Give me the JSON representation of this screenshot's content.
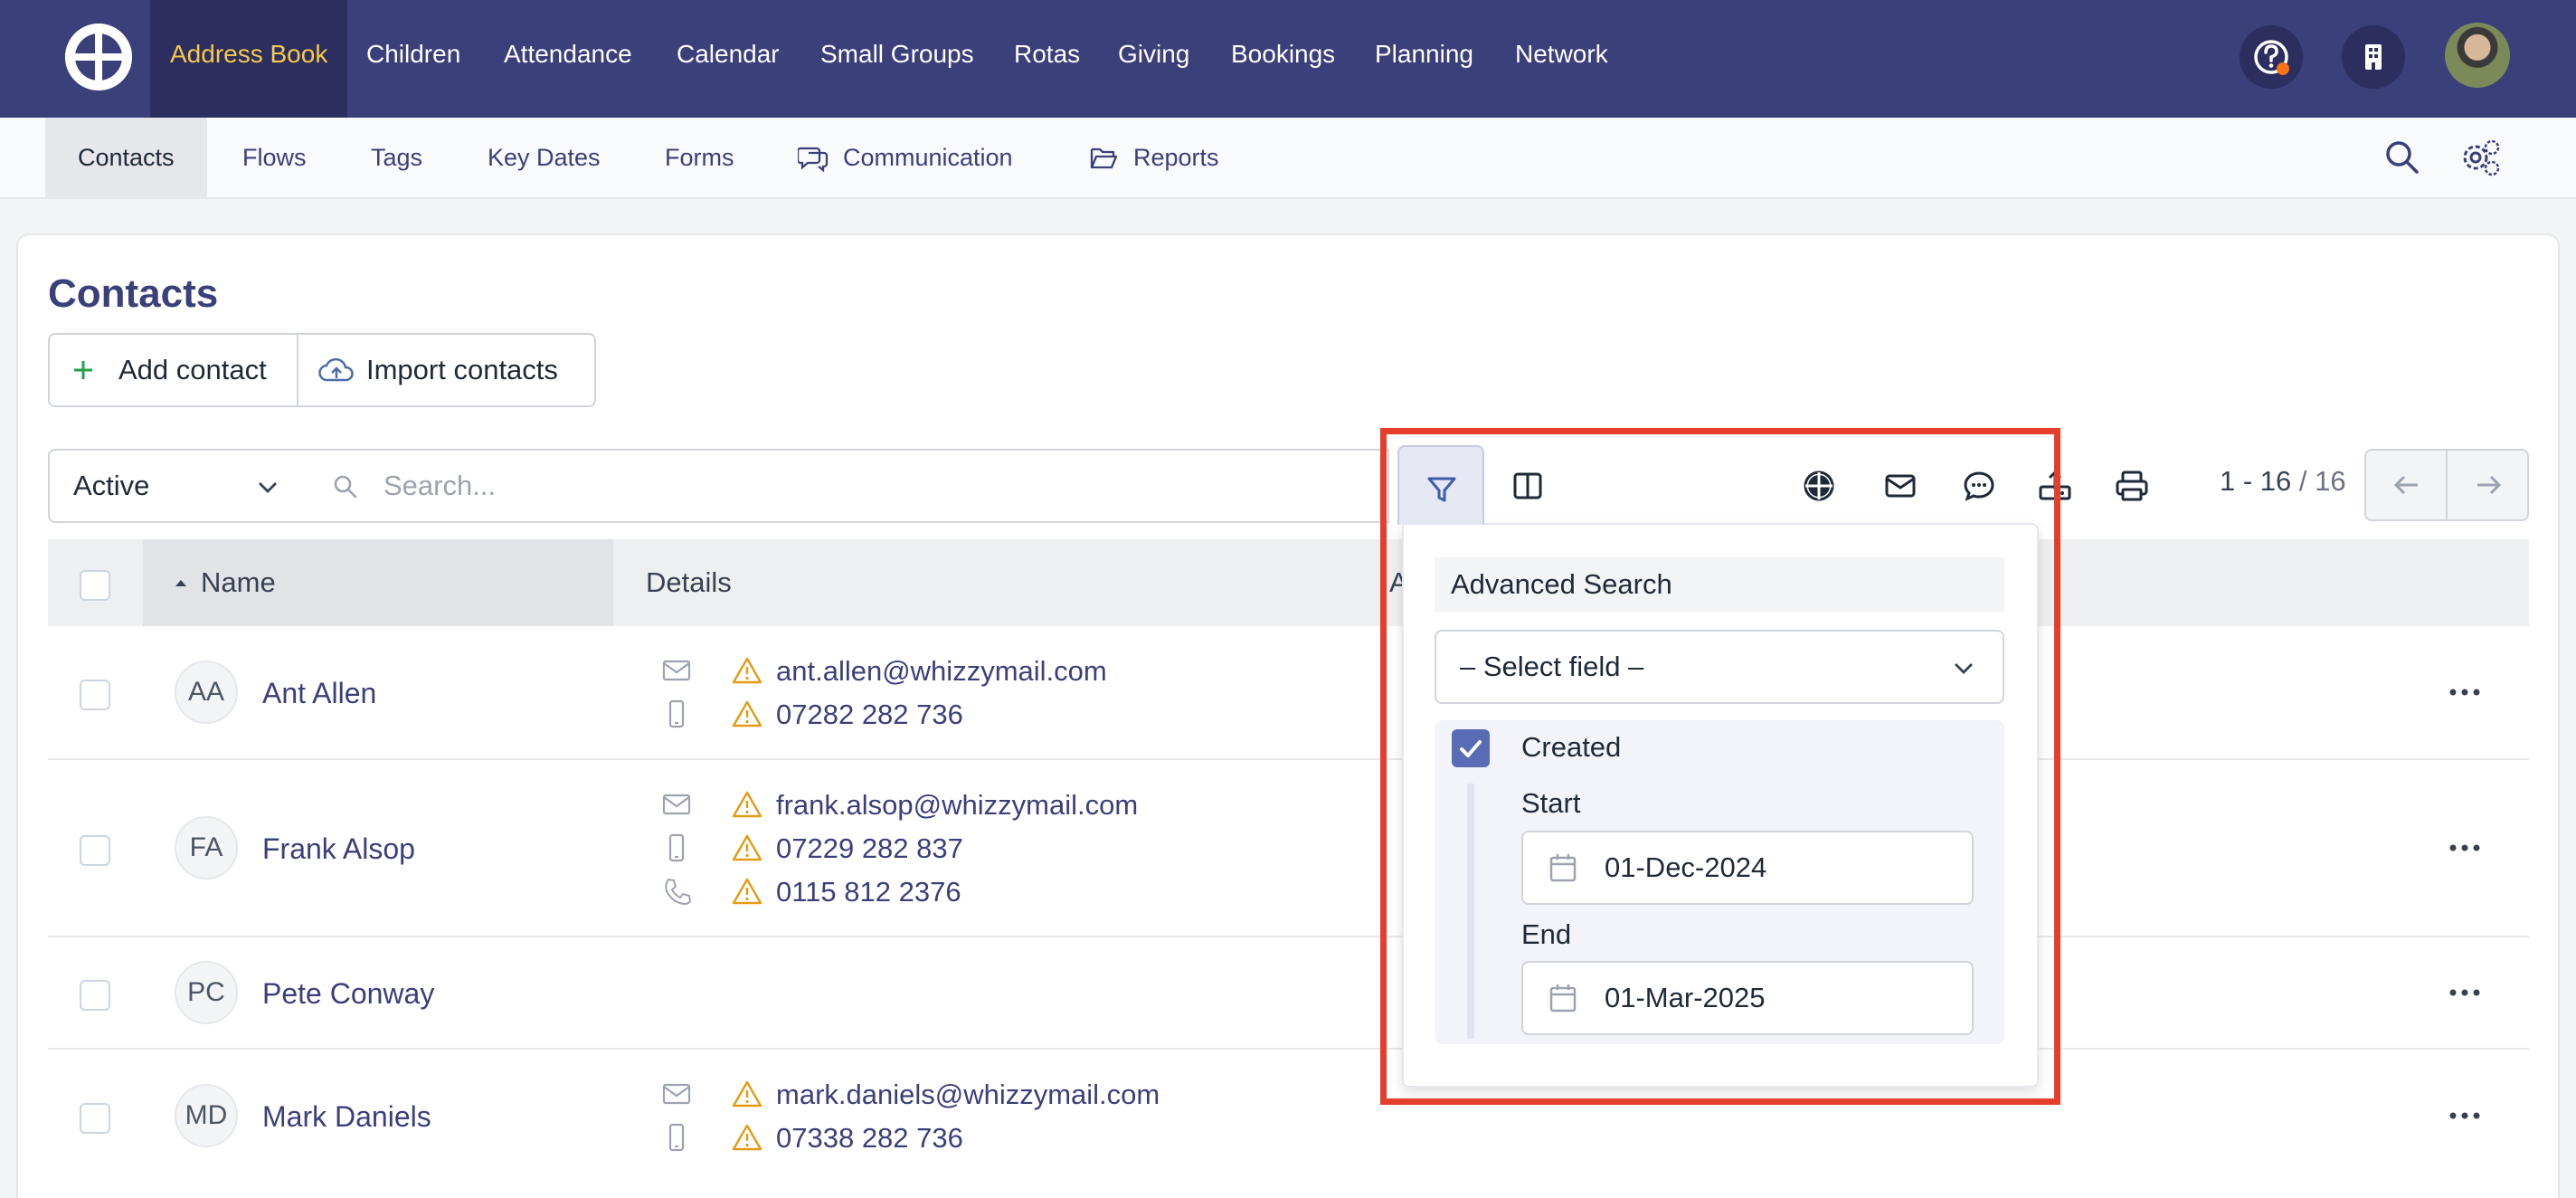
{
  "topnav": {
    "items": [
      "Address Book",
      "Children",
      "Attendance",
      "Calendar",
      "Small Groups",
      "Rotas",
      "Giving",
      "Bookings",
      "Planning",
      "Network"
    ],
    "active": "Address Book",
    "accent_color": "#f7c84b",
    "bg_color": "#3b3f7a",
    "icons": [
      "help-icon",
      "building-icon"
    ]
  },
  "subnav": {
    "items": [
      "Contacts",
      "Flows",
      "Tags",
      "Key Dates",
      "Forms",
      "Communication",
      "Reports"
    ],
    "active": "Contacts"
  },
  "page": {
    "title": "Contacts",
    "add_label": "Add contact",
    "import_label": "Import contacts"
  },
  "filters": {
    "status_value": "Active",
    "search_placeholder": "Search...",
    "pagination_range": "1 - 16",
    "pagination_sep": " / ",
    "pagination_total": "16"
  },
  "table": {
    "headers": {
      "name": "Name",
      "details": "Details",
      "partial": "A"
    },
    "rows": [
      {
        "initials": "AA",
        "name": "Ant Allen",
        "details": [
          {
            "type": "email",
            "value": "ant.allen@whizzymail.com"
          },
          {
            "type": "mobile",
            "value": "07282 282 736"
          }
        ]
      },
      {
        "initials": "FA",
        "name": "Frank Alsop",
        "details": [
          {
            "type": "email",
            "value": "frank.alsop@whizzymail.com"
          },
          {
            "type": "mobile",
            "value": "07229 282 837"
          },
          {
            "type": "phone",
            "value": "0115 812 2376"
          }
        ]
      },
      {
        "initials": "PC",
        "name": "Pete Conway",
        "details": []
      },
      {
        "initials": "MD",
        "name": "Mark Daniels",
        "details": [
          {
            "type": "email",
            "value": "mark.daniels@whizzymail.com"
          },
          {
            "type": "mobile",
            "value": "07338 282 736"
          }
        ]
      }
    ]
  },
  "advanced_search": {
    "title": "Advanced Search",
    "select_placeholder": "– Select field –",
    "created_label": "Created",
    "created_checked": true,
    "start_label": "Start",
    "start_value": "01-Dec-2024",
    "end_label": "End",
    "end_value": "01-Mar-2025",
    "highlight_color": "#e53e2b"
  }
}
